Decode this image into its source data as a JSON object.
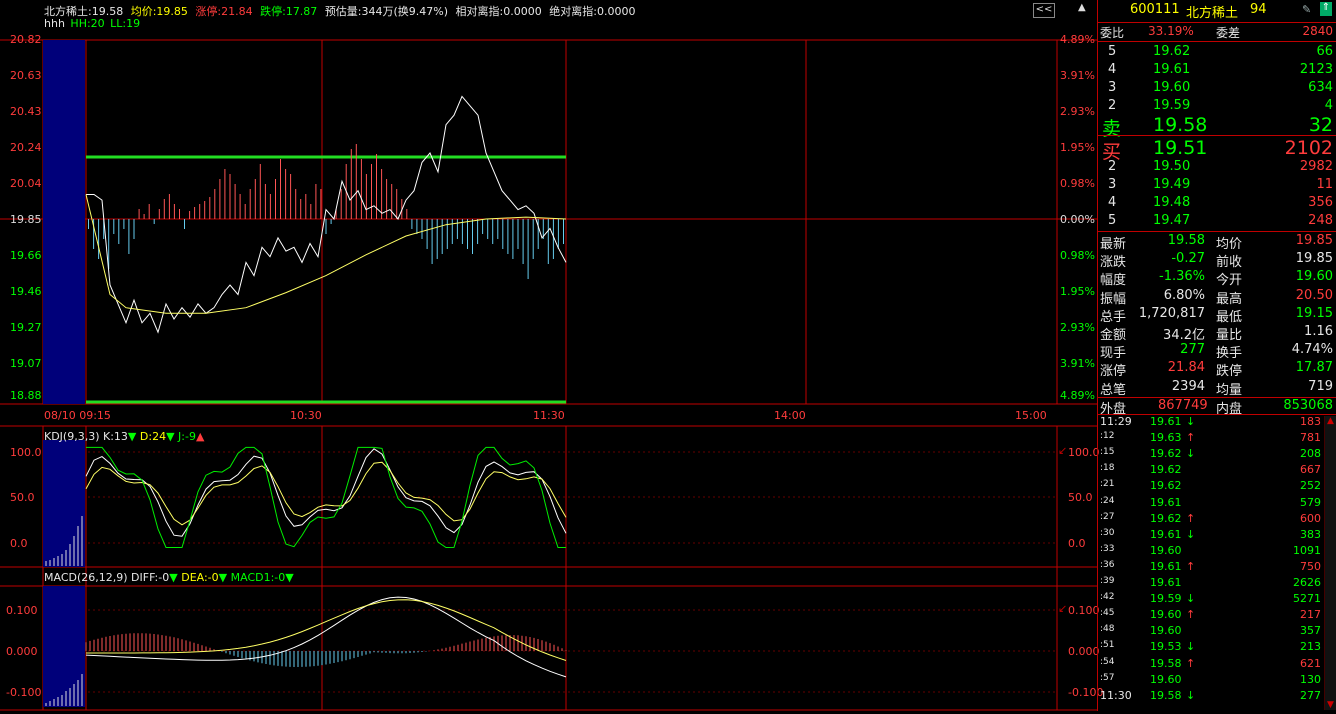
{
  "header": {
    "name_price": "北方稀土:19.58",
    "avg": "均价:19.85",
    "limit_up": "涨停:21.84",
    "limit_down": "跌停:17.87",
    "est_volume": "预估量:344万(换9.47%)",
    "rel_index": "相对离指:0.0000",
    "abs_index": "绝对离指:0.0000",
    "line2_a": "hhh",
    "line2_b": "HH:20",
    "line2_c": "LL:19",
    "collapse_btn": "<<",
    "scroll_up": "▲",
    "top_right_icon": "◈"
  },
  "main_axis": {
    "left": [
      "20.82",
      "20.63",
      "20.43",
      "20.24",
      "20.04",
      "19.85",
      "19.66",
      "19.46",
      "19.27",
      "19.07",
      "18.88"
    ],
    "right": [
      "4.89%",
      "3.91%",
      "2.93%",
      "1.95%",
      "0.98%",
      "0.00%",
      "0.98%",
      "1.95%",
      "2.93%",
      "3.91%",
      "4.89%"
    ],
    "time": [
      "08/10 09:15",
      "10:30",
      "11:30",
      "14:00",
      "15:00"
    ]
  },
  "kdj": {
    "title": "KDJ(9,3,3)",
    "k": "K:13",
    "d": "D:24",
    "j": "J:-9",
    "axis": [
      "100.0",
      "50.0",
      "0.0"
    ]
  },
  "macd": {
    "title": "MACD(26,12,9)",
    "diff": "DIFF:-0",
    "dea": "DEA:-0",
    "macd1": "MACD1:-0",
    "axis": [
      "0.100",
      "0.000",
      "-0.100"
    ]
  },
  "quote": {
    "code": "600111",
    "name": "北方稀土",
    "num": "94",
    "ratio_label": "委比",
    "ratio": "33.19%",
    "diff_label": "委差",
    "diff": "2840",
    "sell": [
      {
        "lvl": "5",
        "price": "19.62",
        "vol": "66"
      },
      {
        "lvl": "4",
        "price": "19.61",
        "vol": "2123"
      },
      {
        "lvl": "3",
        "price": "19.60",
        "vol": "634"
      },
      {
        "lvl": "2",
        "price": "19.59",
        "vol": "4"
      },
      {
        "lvl": "卖",
        "price": "19.58",
        "vol": "32"
      }
    ],
    "buy": [
      {
        "lvl": "买",
        "price": "19.51",
        "vol": "2102"
      },
      {
        "lvl": "2",
        "price": "19.50",
        "vol": "2982"
      },
      {
        "lvl": "3",
        "price": "19.49",
        "vol": "11"
      },
      {
        "lvl": "4",
        "price": "19.48",
        "vol": "356"
      },
      {
        "lvl": "5",
        "price": "19.47",
        "vol": "248"
      }
    ],
    "stats": [
      {
        "l1": "最新",
        "v1": "19.58",
        "l2": "均价",
        "v2": "19.85"
      },
      {
        "l1": "涨跌",
        "v1": "-0.27",
        "l2": "前收",
        "v2": "19.85"
      },
      {
        "l1": "幅度",
        "v1": "-1.36%",
        "l2": "今开",
        "v2": "19.60"
      },
      {
        "l1": "振幅",
        "v1": "6.80%",
        "l2": "最高",
        "v2": "20.50"
      },
      {
        "l1": "总手",
        "v1": "1,720,817",
        "l2": "最低",
        "v2": "19.15"
      },
      {
        "l1": "金额",
        "v1": "34.2亿",
        "l2": "量比",
        "v2": "1.16"
      },
      {
        "l1": "现手",
        "v1": "277",
        "l2": "换手",
        "v2": "4.74%"
      },
      {
        "l1": "涨停",
        "v1": "21.84",
        "l2": "跌停",
        "v2": "17.87"
      },
      {
        "l1": "总笔",
        "v1": "2394",
        "l2": "均量",
        "v2": "719"
      }
    ],
    "outer_label": "外盘",
    "outer": "867749",
    "inner_label": "内盘",
    "inner": "853068"
  },
  "ticks": [
    {
      "t": "11:29",
      "p": "19.61",
      "a": "↓",
      "v": "183"
    },
    {
      "t": ":12",
      "p": "19.63",
      "a": "↑",
      "v": "781"
    },
    {
      "t": ":15",
      "p": "19.62",
      "a": "↓",
      "v": "208"
    },
    {
      "t": ":18",
      "p": "19.62",
      "a": "",
      "v": "667"
    },
    {
      "t": ":21",
      "p": "19.62",
      "a": "",
      "v": "252"
    },
    {
      "t": ":24",
      "p": "19.61",
      "a": "",
      "v": "579"
    },
    {
      "t": ":27",
      "p": "19.62",
      "a": "↑",
      "v": "600"
    },
    {
      "t": ":30",
      "p": "19.61",
      "a": "↓",
      "v": "383"
    },
    {
      "t": ":33",
      "p": "19.60",
      "a": "",
      "v": "1091"
    },
    {
      "t": ":36",
      "p": "19.61",
      "a": "↑",
      "v": "750"
    },
    {
      "t": ":39",
      "p": "19.61",
      "a": "",
      "v": "2626"
    },
    {
      "t": ":42",
      "p": "19.59",
      "a": "↓",
      "v": "5271"
    },
    {
      "t": ":45",
      "p": "19.60",
      "a": "↑",
      "v": "217"
    },
    {
      "t": ":48",
      "p": "19.60",
      "a": "",
      "v": "357"
    },
    {
      "t": ":51",
      "p": "19.53",
      "a": "↓",
      "v": "213"
    },
    {
      "t": ":54",
      "p": "19.58",
      "a": "↑",
      "v": "621"
    },
    {
      "t": ":57",
      "p": "19.60",
      "a": "",
      "v": "130"
    },
    {
      "t": "11:30",
      "p": "19.58",
      "a": "↓",
      "v": "277"
    }
  ],
  "colors": {
    "up": "#ff3c3c",
    "down": "#00ff00",
    "grid": "#c00000",
    "avg": "#ffff00",
    "price": "#ffffff"
  }
}
